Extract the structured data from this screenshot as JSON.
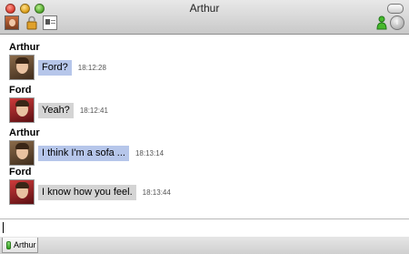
{
  "window": {
    "title": "Arthur"
  },
  "toolbar": {
    "icons": [
      "user-avatar-icon",
      "lock-icon",
      "contact-card-icon",
      "status-person-icon",
      "info-icon"
    ]
  },
  "messages": [
    {
      "sender": "Arthur",
      "text": "Ford?",
      "time": "18:12:28",
      "bubble_color": "#b6c6ea"
    },
    {
      "sender": "Ford",
      "text": "Yeah?",
      "time": "18:12:41",
      "bubble_color": "#d4d4d4"
    },
    {
      "sender": "Arthur",
      "text": "I think I'm a sofa ...",
      "time": "18:13:14",
      "bubble_color": "#b6c6ea"
    },
    {
      "sender": "Ford",
      "text": "I know how you feel.",
      "time": "18:13:44",
      "bubble_color": "#d4d4d4"
    }
  ],
  "input": {
    "value": "",
    "placeholder": ""
  },
  "tabs": [
    {
      "label": "Arthur",
      "status": "available"
    }
  ]
}
